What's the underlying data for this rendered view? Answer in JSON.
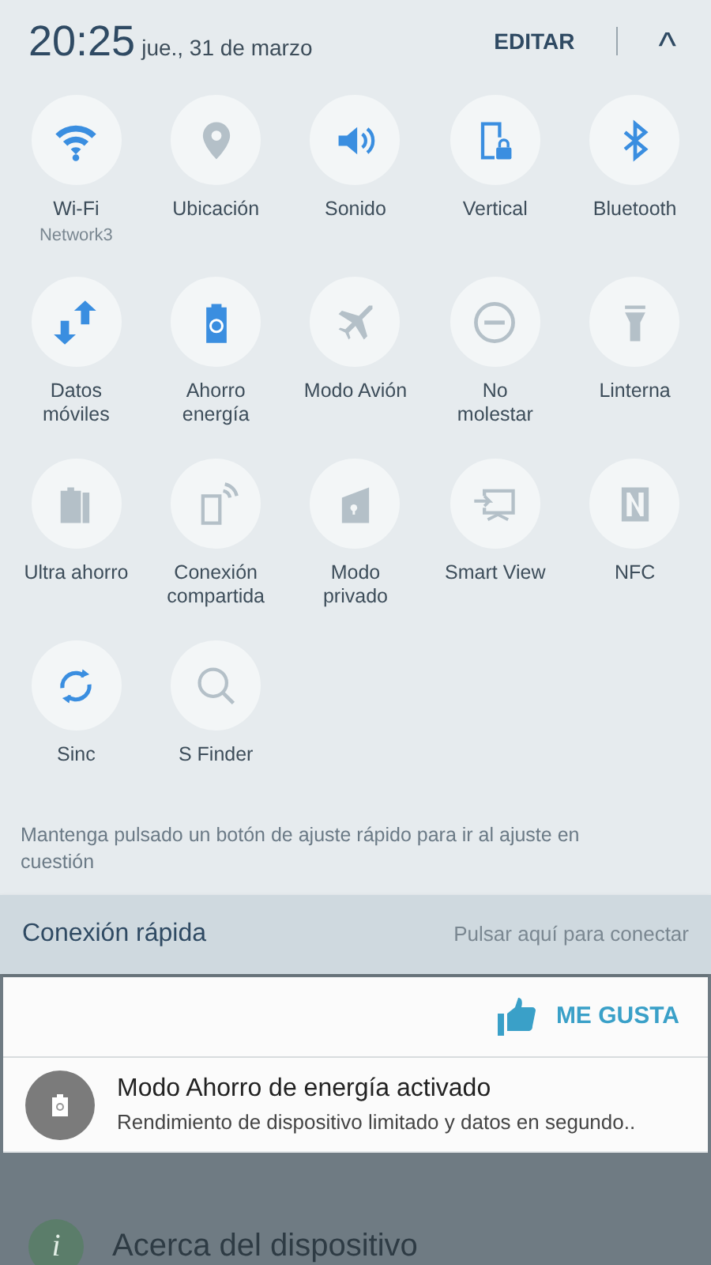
{
  "header": {
    "time": "20:25",
    "date": "jue., 31 de marzo",
    "edit": "EDITAR",
    "collapse": "^"
  },
  "tiles": [
    {
      "label": "Wi-Fi",
      "sublabel": "Network3",
      "on": true
    },
    {
      "label": "Ubicación",
      "on": false
    },
    {
      "label": "Sonido",
      "on": true
    },
    {
      "label": "Vertical",
      "on": true
    },
    {
      "label": "Bluetooth",
      "on": true
    },
    {
      "label": "Datos móviles",
      "on": true
    },
    {
      "label": "Ahorro energía",
      "on": true
    },
    {
      "label": "Modo Avión",
      "on": false
    },
    {
      "label": "No molestar",
      "on": false
    },
    {
      "label": "Linterna",
      "on": false
    },
    {
      "label": "Ultra ahorro",
      "on": false
    },
    {
      "label": "Conexión compartida",
      "on": false
    },
    {
      "label": "Modo privado",
      "on": false
    },
    {
      "label": "Smart View",
      "on": false
    },
    {
      "label": "NFC",
      "on": false
    },
    {
      "label": "Sinc",
      "on": true
    },
    {
      "label": "S Finder",
      "on": false
    }
  ],
  "hint": "Mantenga pulsado un botón de ajuste rápido para ir al ajuste en cuestión",
  "quick_connect": {
    "title": "Conexión rápida",
    "action": "Pulsar aquí para conectar"
  },
  "like_card": {
    "button": "ME GUSTA"
  },
  "notification": {
    "title": "Modo Ahorro de energía activado",
    "text": "Rendimiento de dispositivo limitado y datos en segundo.."
  },
  "background_list": [
    {
      "label": "Acerca del dispositivo",
      "icon": "i"
    }
  ]
}
